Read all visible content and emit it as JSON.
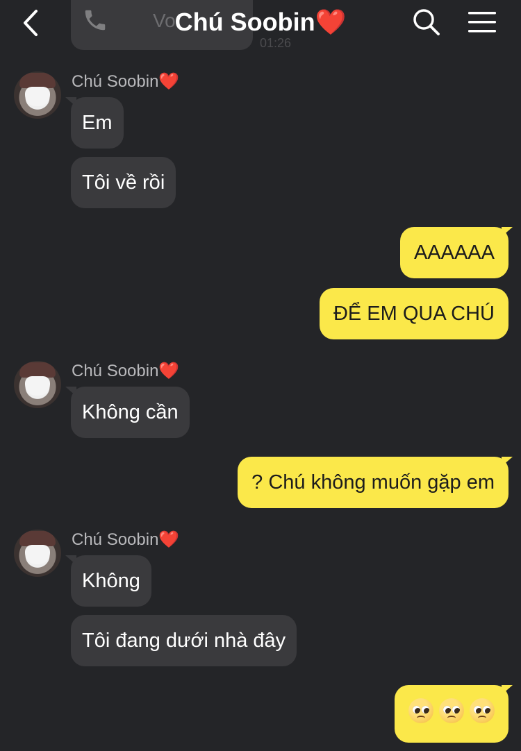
{
  "header": {
    "title": "Chú Soobin❤️",
    "back_icon": "chevron-left-icon",
    "search_icon": "search-icon",
    "menu_icon": "hamburger-menu-icon"
  },
  "previous_message": {
    "icon": "phone-icon",
    "label_partial": "Vo",
    "time_partial": "01:26"
  },
  "contact": {
    "name": "Chú Soobin❤️"
  },
  "messages": [
    {
      "from": "them",
      "text": "Em"
    },
    {
      "from": "them",
      "text": "Tôi về rồi"
    },
    {
      "from": "me",
      "text": "AAAAAA"
    },
    {
      "from": "me",
      "text": "ĐỂ EM QUA CHÚ"
    },
    {
      "from": "them",
      "text": "Không cần"
    },
    {
      "from": "me",
      "text": "? Chú không muốn gặp em"
    },
    {
      "from": "them",
      "text": "Không"
    },
    {
      "from": "them",
      "text": "Tôi đang dưới nhà đây"
    },
    {
      "from": "me",
      "emoji": [
        "pleading-face",
        "pleading-face",
        "pleading-face"
      ]
    }
  ],
  "colors": {
    "background": "#242528",
    "incoming_bubble": "#3a3a3d",
    "outgoing_bubble": "#fbe84a",
    "sender_name": "#b9b9bc"
  }
}
